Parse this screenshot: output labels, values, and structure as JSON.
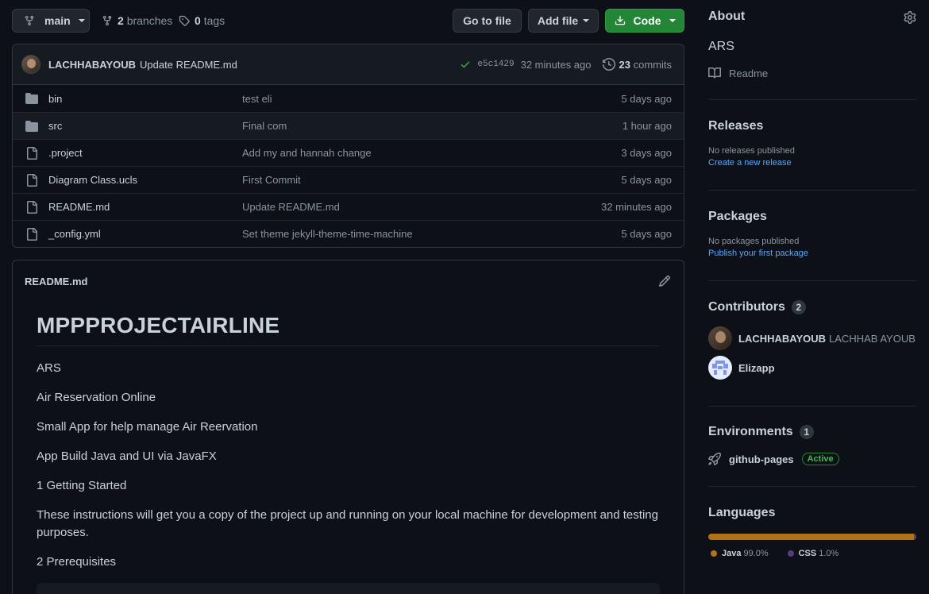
{
  "toolbar": {
    "branch": "main",
    "branches_count": "2",
    "branches_label": "branches",
    "tags_count": "0",
    "tags_label": "tags",
    "go_to_file": "Go to file",
    "add_file": "Add file",
    "code": "Code"
  },
  "latest_commit": {
    "author": "LACHHABAYOUB",
    "message": "Update README.md",
    "sha": "e5c1429",
    "age": "32 minutes ago",
    "commits_count": "23",
    "commits_label": "commits"
  },
  "files": [
    {
      "type": "folder",
      "name": "bin",
      "commit": "test eli",
      "age": "5 days ago"
    },
    {
      "type": "folder",
      "name": "src",
      "commit": "Final com",
      "age": "1 hour ago"
    },
    {
      "type": "file",
      "name": ".project",
      "commit": "Add my and hannah change",
      "age": "3 days ago"
    },
    {
      "type": "file",
      "name": "Diagram Class.ucls",
      "commit": "First Commit",
      "age": "5 days ago"
    },
    {
      "type": "file",
      "name": "README.md",
      "commit": "Update README.md",
      "age": "32 minutes ago"
    },
    {
      "type": "file",
      "name": "_config.yml",
      "commit": "Set theme jekyll-theme-time-machine",
      "age": "5 days ago"
    }
  ],
  "readme": {
    "filename": "README.md",
    "heading": "MPPPROJECTAIRLINE",
    "paragraphs": [
      "ARS",
      "Air Reservation Online",
      "Small App for help manage Air Reervation",
      "App Build Java and UI via JavaFX",
      "1 Getting Started",
      "These instructions will get you a copy of the project up and running on your local machine for development and testing purposes.",
      "2 Prerequisites"
    ]
  },
  "about": {
    "title": "About",
    "description": "ARS",
    "readme_link": "Readme"
  },
  "releases": {
    "title": "Releases",
    "empty": "No releases published",
    "link": "Create a new release"
  },
  "packages": {
    "title": "Packages",
    "empty": "No packages published",
    "link": "Publish your first package"
  },
  "contributors": {
    "title": "Contributors",
    "count": "2",
    "items": [
      {
        "login": "LACHHABAYOUB",
        "name": "LACHHAB AYOUB"
      },
      {
        "login": "Elizapp",
        "name": ""
      }
    ]
  },
  "environments": {
    "title": "Environments",
    "count": "1",
    "name": "github-pages",
    "status": "Active"
  },
  "languages": {
    "title": "Languages",
    "items": [
      {
        "name": "Java",
        "percent": "99.0%",
        "value": 99.0,
        "color": "#b07219"
      },
      {
        "name": "CSS",
        "percent": "1.0%",
        "value": 1.0,
        "color": "#563d7c"
      }
    ]
  },
  "icons": [
    "branch-icon",
    "tag-icon",
    "download-icon",
    "check-icon",
    "history-icon",
    "folder-icon",
    "file-icon",
    "pencil-icon",
    "gear-icon",
    "book-icon",
    "rocket-icon"
  ]
}
